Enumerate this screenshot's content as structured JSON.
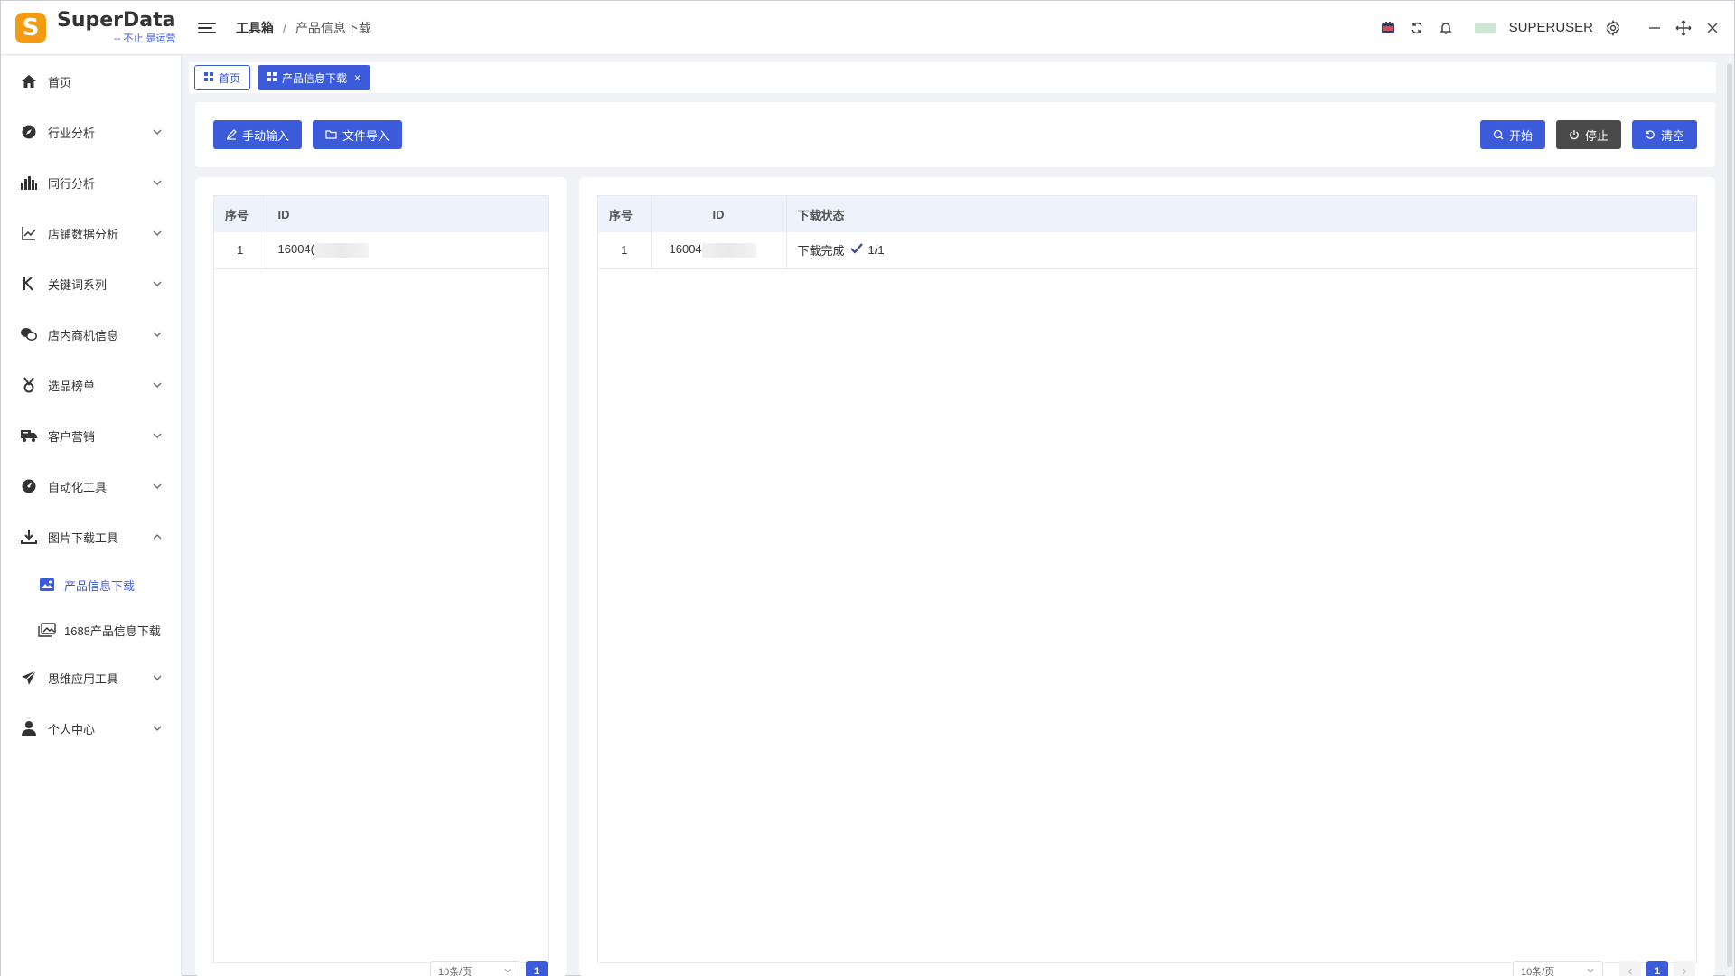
{
  "app": {
    "name": "SuperData",
    "slogan": "-- 不止 是运营"
  },
  "header": {
    "breadcrumb_root": "工具箱",
    "breadcrumb_sep": "/",
    "breadcrumb_current": "产品信息下载",
    "username": "SUPERUSER"
  },
  "sidebar": {
    "items": [
      {
        "label": "首页",
        "icon": "home-icon"
      },
      {
        "label": "行业分析",
        "icon": "compass-icon"
      },
      {
        "label": "同行分析",
        "icon": "bar-chart-icon"
      },
      {
        "label": "店铺数据分析",
        "icon": "line-chart-icon"
      },
      {
        "label": "关键词系列",
        "icon": "k-letter-icon"
      },
      {
        "label": "店内商机信息",
        "icon": "chat-icon"
      },
      {
        "label": "选品榜单",
        "icon": "medal-icon"
      },
      {
        "label": "客户营销",
        "icon": "truck-icon"
      },
      {
        "label": "自动化工具",
        "icon": "dashboard-icon"
      },
      {
        "label": "图片下载工具",
        "icon": "download-icon"
      },
      {
        "label": "思维应用工具",
        "icon": "send-icon"
      },
      {
        "label": "个人中心",
        "icon": "user-icon"
      }
    ],
    "sub_items": [
      {
        "label": "产品信息下载",
        "icon": "image-icon"
      },
      {
        "label": "1688产品信息下载",
        "icon": "images-icon"
      }
    ]
  },
  "tabs": {
    "home": "首页",
    "current": "产品信息下载",
    "close": "×"
  },
  "toolbar": {
    "manual_input": "手动输入",
    "file_import": "文件导入",
    "start": "开始",
    "stop": "停止",
    "clear": "清空"
  },
  "left_table": {
    "headers": [
      "序号",
      "ID"
    ],
    "rows": [
      {
        "index": "1",
        "id": "16004("
      }
    ]
  },
  "right_table": {
    "headers": [
      "序号",
      "ID",
      "下载状态"
    ],
    "rows": [
      {
        "index": "1",
        "id": "16004",
        "status": "下载完成",
        "progress": "1/1"
      }
    ]
  },
  "pagination": {
    "page_size": "10条/页",
    "current_page": "1"
  },
  "colors": {
    "primary": "#3b5bdb",
    "logo": "#f39c12",
    "dark_button": "#4a4a4a"
  }
}
